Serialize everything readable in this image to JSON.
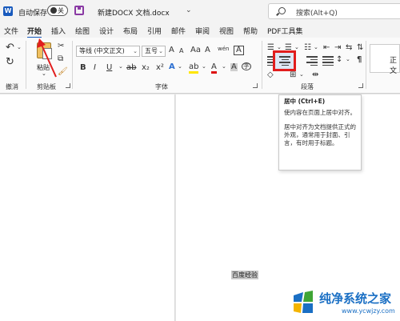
{
  "titlebar": {
    "app_icon": "W",
    "autosave_label": "自动保存",
    "autosave_state": "关",
    "doc_title": "新建DOCX 文档.docx",
    "search_placeholder": "搜索(Alt+Q)"
  },
  "tabs": [
    "文件",
    "开始",
    "插入",
    "绘图",
    "设计",
    "布局",
    "引用",
    "邮件",
    "审阅",
    "视图",
    "帮助",
    "PDF工具集"
  ],
  "active_tab": "开始",
  "ribbon": {
    "undo_group": "撤消",
    "clipboard": {
      "paste_label": "粘贴",
      "group_label": "剪贴板"
    },
    "font": {
      "font_name": "等线 (中文正文)",
      "font_size": "五号",
      "group_label": "字体",
      "bold": "B",
      "italic": "I",
      "underline": "U",
      "strike": "ab",
      "subscript": "x₂",
      "superscript": "x²",
      "grow": "A",
      "shrink": "A",
      "case": "Aa",
      "clear": "A",
      "phonetic": "wén",
      "border_char": "A",
      "effects": "A",
      "highlight": "ab",
      "font_color": "A",
      "shade": "A",
      "circled": "字"
    },
    "paragraph": {
      "group_label": "段落"
    },
    "styles": {
      "first_style": "正文"
    }
  },
  "tooltip": {
    "title": "居中 (Ctrl+E)",
    "line1": "使内容在页面上居中对齐。",
    "line2": "居中对齐为文档提供正式的外观，通常用于封面、引言，有时用于标题。"
  },
  "document": {
    "selected_text": "百度经验"
  },
  "watermark": {
    "brand": "纯净系统之家",
    "url": "www.ycwjzy.com"
  },
  "colors": {
    "accent": "#185abd",
    "highlight_red": "#e11d1d",
    "watermark_blue": "#1a6fc4"
  }
}
